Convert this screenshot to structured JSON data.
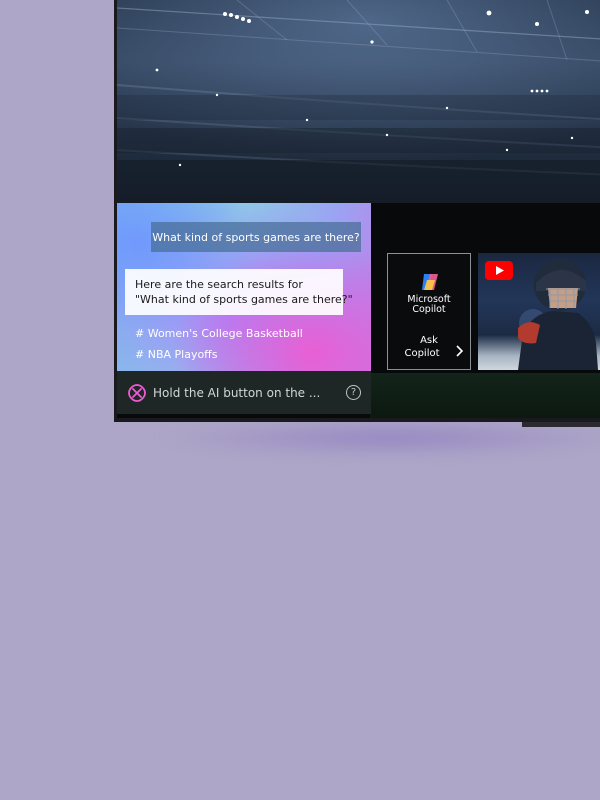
{
  "assistant": {
    "user_query": "What kind of sports games are there?",
    "response_line1": "Here are the search results for",
    "response_line2": "\"What kind of sports games are there?\"",
    "tags": [
      {
        "label": "# Women's College Basketball"
      },
      {
        "label": "# NBA Playoffs"
      }
    ],
    "hint": "Hold the AI button on the ...",
    "help_glyph": "?"
  },
  "copilot_card": {
    "name_line1": "Microsoft",
    "name_line2": "Copilot",
    "ask_line1": "Ask",
    "ask_line2": "Copilot"
  },
  "icons": {
    "ai_logo": "ai-knot-icon",
    "help": "question-icon",
    "copilot": "copilot-logo-icon",
    "chevron": "chevron-right-icon",
    "youtube": "youtube-icon"
  },
  "colors": {
    "page_background": "#aea6c8",
    "youtube_red": "#ff0000",
    "ai_accent_pink": "#ec5cd2"
  }
}
